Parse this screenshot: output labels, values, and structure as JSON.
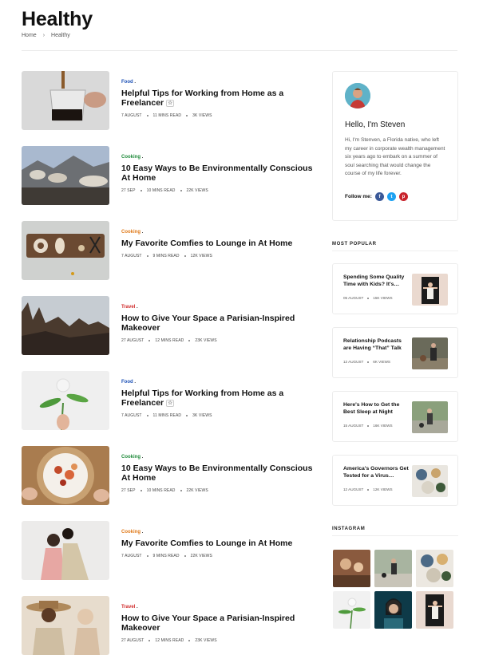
{
  "page": {
    "title": "Healthy",
    "breadcrumb": {
      "home": "Home",
      "separator": "›",
      "current": "Healthy"
    }
  },
  "colors": {
    "food": "#1a4fb5",
    "cooking": "#1f8a3a",
    "travel": "#d02b2b",
    "cooking_alt": "#e07a1a"
  },
  "articles": [
    {
      "category": "Food",
      "title": "Helpful Tips for Working from Home as a Freelancer",
      "date": "7 AUGUST",
      "read": "11 MINS READ",
      "views": "3K VIEWS"
    },
    {
      "category": "Cooking",
      "title": "10 Easy Ways to Be Environmentally Conscious At Home",
      "date": "27 SEP",
      "read": "10 MINS READ",
      "views": "22K VIEWS"
    },
    {
      "category": "Cooking",
      "title": "My Favorite Comfies to Lounge in At Home",
      "date": "7 AUGUST",
      "read": "9 MINS READ",
      "views": "12K VIEWS"
    },
    {
      "category": "Travel",
      "title": "How to Give Your Space a Parisian-Inspired Makeover",
      "date": "27 AUGUST",
      "read": "12 MINS READ",
      "views": "23K VIEWS"
    },
    {
      "category": "Food",
      "title": "Helpful Tips for Working from Home as a Freelancer",
      "date": "7 AUGUST",
      "read": "11 MINS READ",
      "views": "3K VIEWS"
    },
    {
      "category": "Cooking",
      "title": "10 Easy Ways to Be Environmentally Conscious At Home",
      "date": "27 SEP",
      "read": "10 MINS READ",
      "views": "22K VIEWS"
    },
    {
      "category": "Cooking",
      "title": "My Favorite Comfies to Lounge in At Home",
      "date": "7 AUGUST",
      "read": "9 MINS READ",
      "views": "22K VIEWS"
    },
    {
      "category": "Travel",
      "title": "How to Give Your Space a Parisian-Inspired Makeover",
      "date": "27 AUGUST",
      "read": "12 MINS READ",
      "views": "23K VIEWS"
    }
  ],
  "author": {
    "greeting": "Hello, I'm Steven",
    "bio": "Hi, I'm Stenven, a Florida native, who left my career in corporate wealth management six years ago to embark on a summer of soul searching that would change the course of my life forever.",
    "follow_label": "Follow me:",
    "social": [
      "f",
      "t",
      "p"
    ]
  },
  "sections": {
    "most_popular": "MOST POPULAR",
    "instagram": "INSTAGRAM"
  },
  "popular": [
    {
      "title": "Spending Some Quality Time with Kids? It's…",
      "date": "05 AUGUST",
      "views": "15K VIEWS"
    },
    {
      "title": "Relationship Podcasts are Having “That” Talk",
      "date": "12 AUGUST",
      "views": "6K VIEWS"
    },
    {
      "title": "Here's How to Get the Best Sleep at Night",
      "date": "15 AUGUST",
      "views": "16K VIEWS"
    },
    {
      "title": "America's Governors Get Tested for a Virus…",
      "date": "12 AUGUST",
      "views": "12K VIEWS"
    }
  ],
  "star_icon": "☆"
}
